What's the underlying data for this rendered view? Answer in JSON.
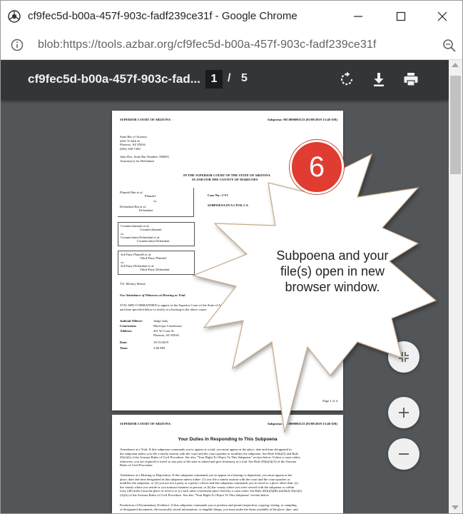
{
  "window": {
    "title": "cf9fec5d-b00a-457f-903c-fadf239ce31f - Google Chrome",
    "address": "blob:https://tools.azbar.org/cf9fec5d-b00a-457f-903c-fadf239ce31f"
  },
  "pdf_toolbar": {
    "filename": "cf9fec5d-b00a-457f-903c-fad...",
    "current_page": "1",
    "separator": "/",
    "total_pages": "5"
  },
  "page1": {
    "court_header": "SUPERIOR COURT OF ARIZONA",
    "subpoena_header": "Subpoena: MC0000001123 (05/08/2019 13:40 AM)",
    "attorney_lines": [
      "State Bar of Arizona",
      "4201 N 24th St",
      "Phoenix, AZ 85016",
      "(602) 340-7200",
      "",
      "John Doe, State Bar Number: 000001",
      "Attorney(s) for Defendant"
    ],
    "court_title": "IN THE SUPERIOR COURT OF THE STATE OF ARIZONA",
    "county_title": "IN AND FOR THE COUNTY OF MARICOPA",
    "case_no": "Case No.: CV1",
    "subpoena_type": "SUBPOENA IN A CIVIL CA",
    "party_box1": [
      "Plaintiff Bnt et al.",
      "Plaintiff",
      "vs.",
      "Defendant Bnt et al.",
      "Defendant"
    ],
    "party_box2": [
      "Counterclaimant et al.",
      "Counterclaimant",
      "vs.",
      "Counterclaim Defendant et al.",
      "Counterclaim Defendant"
    ],
    "party_box3": [
      "3rd Party Plaintiff et al.",
      "Third Party Plaintiff",
      "vs.",
      "3rd Party Defendant et al.",
      "Third Party Defendant"
    ],
    "to_line": "TO: Mickey Mouse",
    "attendance_heading": "For Attendance of Witnesses at Hearing or Trial",
    "commanded_line1": "YOU ARE COMMANDED to appear in the Superior Court of the State of Arizona, in and for",
    "commanded_line2": "and time specified below to testify at a hearing in the above cause:",
    "details": [
      {
        "label": "Judicial Officer:",
        "value": "Judge Judy"
      },
      {
        "label": "Courtroom:",
        "value": "Maricopa Courthouse"
      },
      {
        "label": "Address:",
        "value": "201 W Court St"
      },
      {
        "label": "",
        "value": "Phoenix, AZ 85016"
      },
      {
        "label": "Date:",
        "value": "10/15/2019"
      },
      {
        "label": "Time:",
        "value": "2:00 PM"
      }
    ],
    "footer": "Page 1 of 4"
  },
  "page2": {
    "court_header": "SUPERIOR COURT OF ARIZONA",
    "subpoena_header": "Subpoena: MC0000001123 (05/08/2019 13:40 AM)",
    "heading": "Your Duties In Responding to This Subpoena",
    "para1": [
      "Attendance at a Trial. If this subpoena commands you to appear at a trial, you must appear at the place, date and time designated in",
      "the subpoena unless you file a timely motion with the court and the court quashes or modifies the subpoena. See Rule 45(b)(5) and Rule",
      "45(e)(2) of the Arizona Rules of Civil Procedure. See also \"Your Right To Object To This Subpoena\" section below. Unless a court orders",
      "otherwise, you are required to travel to any part of the state to attend and give testimony at a trial. See Rule 45(b)(3)(A) of the Arizona",
      "Rules of Civil Procedure."
    ],
    "para2": [
      "Attendance at a Hearing or Deposition. If this subpoena commands you to appear at a hearing or deposition, you must appear at the",
      "place, date and time designated in this subpoena unless either: (1) you file a timely motion with the court and the court quashes or",
      "modifies the subpoena; or (2) you are not a party or a party's officer and this subpoena commands you to travel to a place other than: (a)",
      "the county where you reside or you transact business in person; or (b) the county where you were served with the subpoena or within",
      "forty (40) miles from the place of service or (c) such other convenient place fixed by a court order. See Rule 45(b)(3)(B) and Rule 45(e)(2)",
      "(A)(ii) of the Arizona Rules of Civil Procedure. See also \"Your Right To Object To This Subpoena\" section below."
    ],
    "para3": [
      "Production of Documentary Evidence. If this subpoena commands you to produce and permit inspection, copying, testing, or sampling",
      "of designated documents, electronically stored information, or tangible things, you must make the items available at the place, date, and"
    ]
  },
  "callout": {
    "step": "6",
    "text": "Subpoena and your file(s) open in new browser window."
  },
  "colors": {
    "pdf_toolbar": "#323639",
    "viewer_bg": "#525659",
    "step_circle": "#e03c31"
  },
  "icons": [
    "chrome-icon",
    "minimize-icon",
    "maximize-icon",
    "close-icon",
    "info-icon",
    "zoom-icon",
    "rotate-icon",
    "download-icon",
    "print-icon",
    "fit-page-icon",
    "zoom-in-icon",
    "zoom-out-icon"
  ]
}
